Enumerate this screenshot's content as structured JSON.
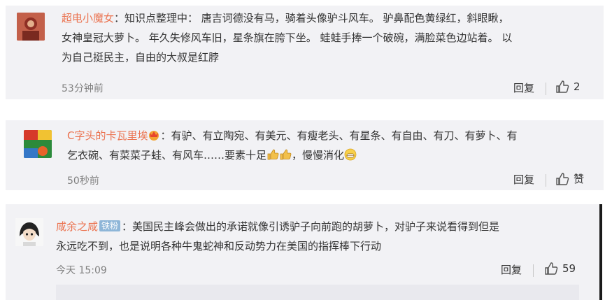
{
  "comments": [
    {
      "username": "超电小魔女",
      "text_line1": "：知识点整理中： 唐吉诃德没有马，骑着头像驴斗风车。 驴鼻配色黄绿红，斜眼瞅，",
      "text_line2": "女神皇冠大萝卜。 年久失修风车旧，星条旗在胯下坐。 蛙蛙手捧一个破碗，满脸菜色边站着。 以",
      "text_line3": "为自己挺民主，自由的大叔是红脖",
      "time": "53分钟前",
      "reply": "回复",
      "likes": "2"
    },
    {
      "username": "C字头的卡瓦里埃",
      "text_line1": "：有驴、有立陶宛、有美元、有瘦老头、有星条、有自由、有刀、有萝卜、有",
      "text_line2a": "乞衣碗、有菜菜子蛙、有风车……要素十足",
      "text_line2b": "，慢慢消化",
      "time": "50秒前",
      "reply": "回复",
      "likes": "赞"
    },
    {
      "username": "咸余之咸",
      "badge": "铁粉",
      "text_line1": "：美国民主峰会做出的承诺就像引诱驴子向前跑的胡萝卜，对驴子来说看得到但是",
      "text_line2": "永远吃不到，也是说明各种牛鬼蛇神和反动势力在美国的指挥棒下行动",
      "time": "今天 15:09",
      "reply": "回复",
      "likes": "59"
    }
  ],
  "colors": {
    "username": "#eb7350",
    "card_bg": "#f2f2f5",
    "meta": "#808080"
  }
}
